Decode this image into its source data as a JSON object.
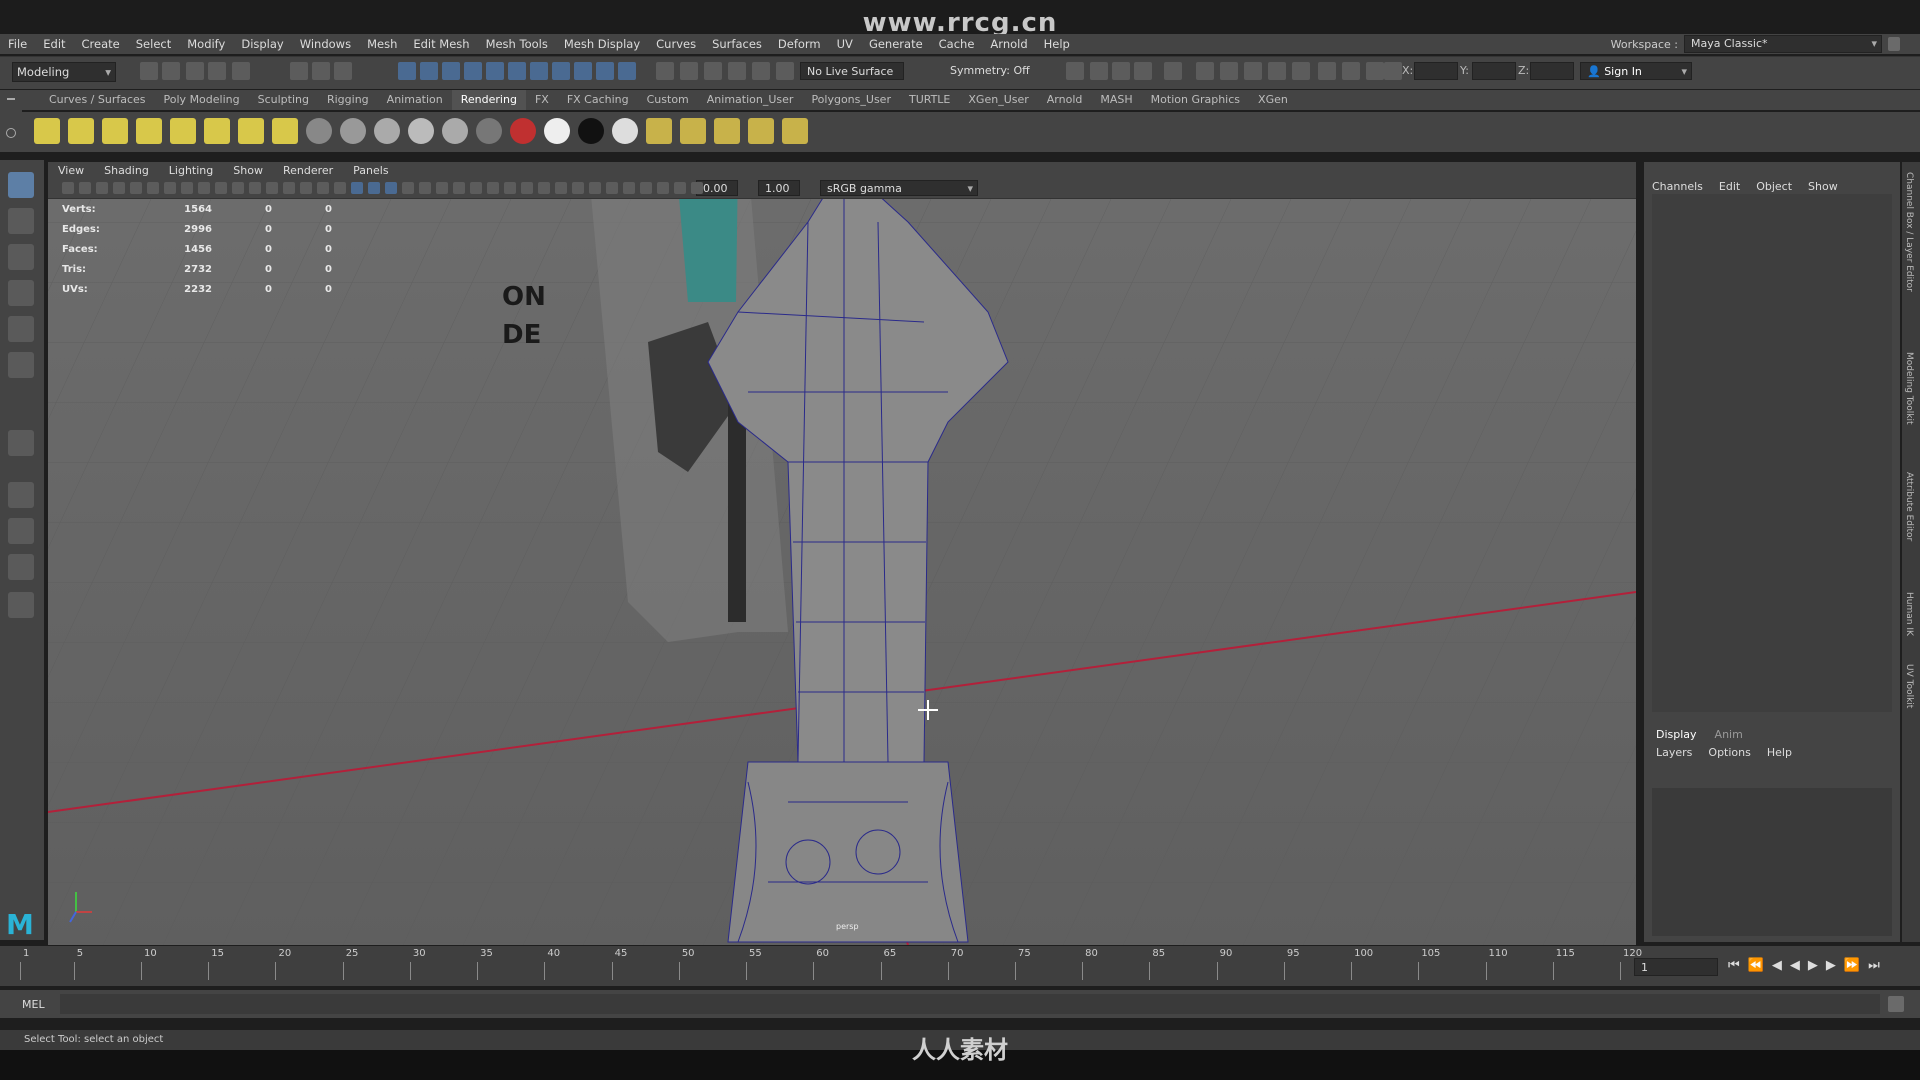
{
  "watermark": {
    "url": "www.rrcg.cn",
    "bottom_logo": "人人素材"
  },
  "menubar": {
    "items": [
      "File",
      "Edit",
      "Create",
      "Select",
      "Modify",
      "Display",
      "Windows",
      "Mesh",
      "Edit Mesh",
      "Mesh Tools",
      "Mesh Display",
      "Curves",
      "Surfaces",
      "Deform",
      "UV",
      "Generate",
      "Cache",
      "Arnold",
      "Help"
    ],
    "workspace_label": "Workspace :",
    "workspace_value": "Maya Classic*"
  },
  "toolbar": {
    "mode": "Modeling",
    "live_surface": "No Live Surface",
    "symmetry": "Symmetry: Off",
    "x_label": "X:",
    "y_label": "Y:",
    "z_label": "Z:",
    "sign_in": "Sign In"
  },
  "shelf": {
    "tabs": [
      "Curves / Surfaces",
      "Poly Modeling",
      "Sculpting",
      "Rigging",
      "Animation",
      "Rendering",
      "FX",
      "FX Caching",
      "Custom",
      "Animation_User",
      "Polygons_User",
      "TURTLE",
      "XGen_User",
      "Arnold",
      "MASH",
      "Motion Graphics",
      "XGen"
    ],
    "active_tab": "Rendering"
  },
  "viewport": {
    "menu": [
      "View",
      "Shading",
      "Lighting",
      "Show",
      "Renderer",
      "Panels"
    ],
    "exposure": "0.00",
    "gamma": "1.00",
    "color_space": "sRGB gamma",
    "hud": [
      {
        "label": "Verts:",
        "value": "1564",
        "sel": "0",
        "comp": "0"
      },
      {
        "label": "Edges:",
        "value": "2996",
        "sel": "0",
        "comp": "0"
      },
      {
        "label": "Faces:",
        "value": "1456",
        "sel": "0",
        "comp": "0"
      },
      {
        "label": "Tris:",
        "value": "2732",
        "sel": "0",
        "comp": "0"
      },
      {
        "label": "UVs:",
        "value": "2232",
        "sel": "0",
        "comp": "0"
      }
    ],
    "ref_text_1": "ON",
    "ref_text_2": "DE",
    "pivot_label": "persp"
  },
  "channel_box": {
    "menu": [
      "Channels",
      "Edit",
      "Object",
      "Show"
    ],
    "tabs": [
      "Display",
      "Anim"
    ],
    "layer_menu": [
      "Layers",
      "Options",
      "Help"
    ]
  },
  "side_tabs": [
    "Channel Box / Layer Editor",
    "Modeling Toolkit",
    "Attribute Editor",
    "Human IK",
    "UV Toolkit"
  ],
  "timeline": {
    "ticks": [
      "1",
      "5",
      "10",
      "15",
      "20",
      "25",
      "30",
      "35",
      "40",
      "45",
      "50",
      "55",
      "60",
      "65",
      "70",
      "75",
      "80",
      "85",
      "90",
      "95",
      "100",
      "105",
      "110",
      "115",
      "120"
    ],
    "current_frame": "1"
  },
  "cmdline": {
    "label": "MEL"
  },
  "helpline": {
    "text": "Select Tool: select an object"
  }
}
